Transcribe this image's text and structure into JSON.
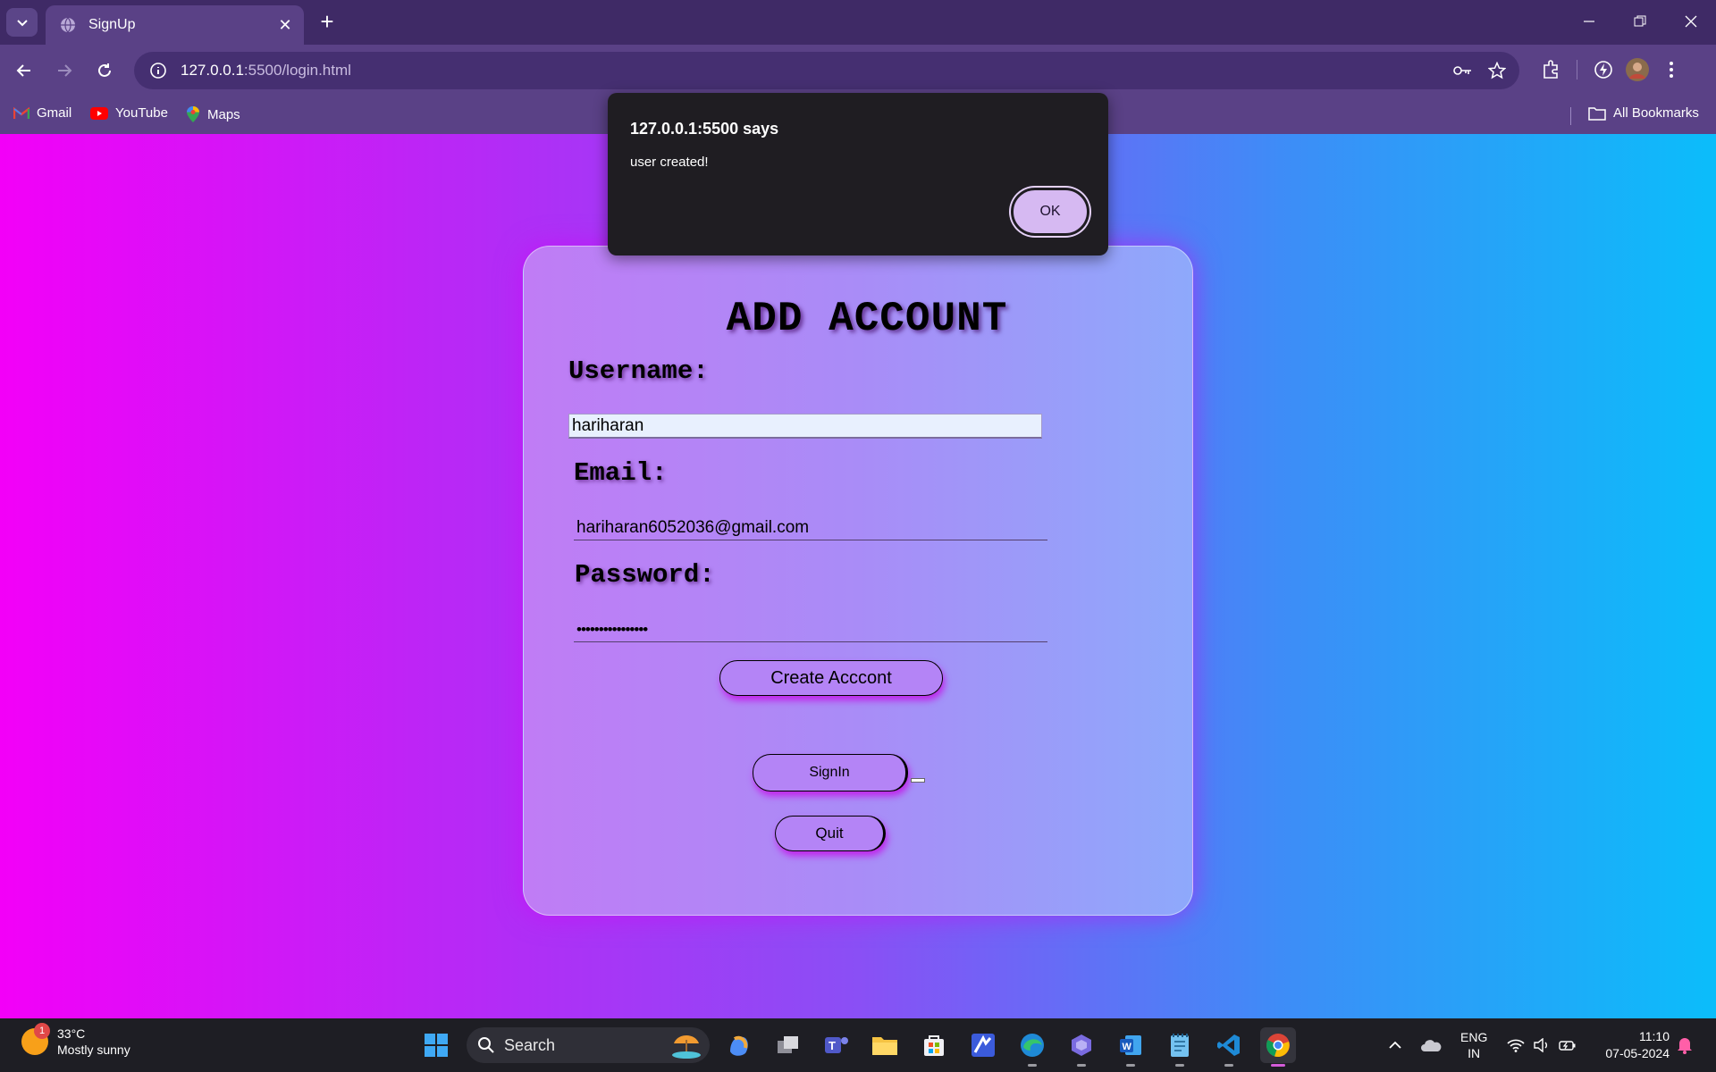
{
  "browser": {
    "tab_title": "SignUp",
    "url_host": "127.0.0.1",
    "url_rest": ":5500/login.html",
    "bookmarks": [
      "Gmail",
      "YouTube",
      "Maps"
    ],
    "all_bookmarks": "All Bookmarks"
  },
  "dialog": {
    "title": "127.0.0.1:5500 says",
    "message": "user created!",
    "ok_label": "OK"
  },
  "form": {
    "title": "ADD ACCOUNT",
    "username_label": "Username:",
    "username_value": "hariharan",
    "email_label": "Email:",
    "email_value": "hariharan6052036@gmail.com",
    "password_label": "Password:",
    "password_value": "••••••••••••••••",
    "create_button": "Create Acccont",
    "signin_button": "SignIn",
    "quit_button": "Quit"
  },
  "taskbar": {
    "weather_badge": "1",
    "temperature": "33°C",
    "weather_text": "Mostly sunny",
    "search_placeholder": "Search",
    "lang_top": "ENG",
    "lang_bottom": "IN",
    "time": "11:10",
    "date": "07-05-2024"
  },
  "colors": {
    "page_gradient_start": "#f300f8",
    "page_gradient_end": "#0bbdfa",
    "chrome_bg": "#5a4186",
    "dialog_bg": "#1f1d22"
  }
}
